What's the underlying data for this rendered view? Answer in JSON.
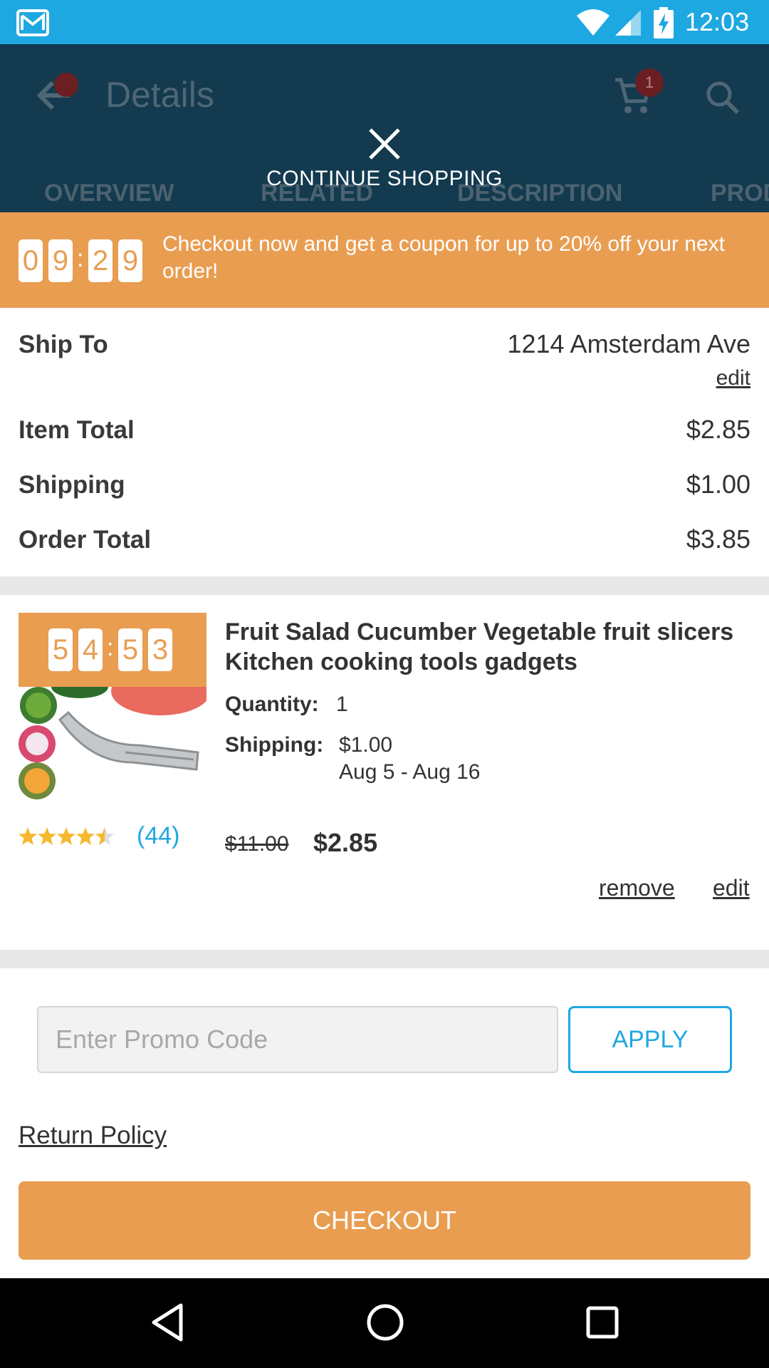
{
  "status_bar": {
    "time": "12:03",
    "color": "#1ea8e1",
    "icons": [
      "mail-icon",
      "wifi-icon",
      "signal-icon",
      "battery-charging-icon"
    ]
  },
  "header": {
    "title": "Details",
    "cart_count": "1",
    "tabs": [
      "OVERVIEW",
      "RELATED",
      "DESCRIPTION",
      "PROD"
    ],
    "background": "#133a4f"
  },
  "overlay": {
    "continue_label": "CONTINUE SHOPPING"
  },
  "banner": {
    "timer": [
      "0",
      "9",
      "2",
      "9"
    ],
    "message": "Checkout now and get a coupon for up to 20% off your next order!",
    "color": "#e99d51"
  },
  "summary": {
    "ship_to_label": "Ship To",
    "ship_to_value": "1214 Amsterdam Ave",
    "edit_label": "edit",
    "item_total_label": "Item Total",
    "item_total_value": "$2.85",
    "shipping_label": "Shipping",
    "shipping_value": "$1.00",
    "order_total_label": "Order Total",
    "order_total_value": "$3.85"
  },
  "product": {
    "timer": [
      "5",
      "4",
      "5",
      "3"
    ],
    "title": "Fruit Salad Cucumber Vegetable fruit slicers Kitchen cooking tools gadgets",
    "quantity_label": "Quantity:",
    "quantity_value": "1",
    "shipping_label": "Shipping:",
    "shipping_value": "$1.00",
    "shipping_dates": "Aug 5 - Aug 16",
    "rating": 4.5,
    "review_count": "(44)",
    "original_price": "$11.00",
    "price": "$2.85",
    "remove_label": "remove",
    "edit_label": "edit"
  },
  "promo": {
    "placeholder": "Enter Promo Code",
    "apply_label": "APPLY"
  },
  "return_policy_label": "Return Policy",
  "checkout_label": "CHECKOUT",
  "accent_blue": "#1ea8e1",
  "accent_orange": "#e99d51"
}
